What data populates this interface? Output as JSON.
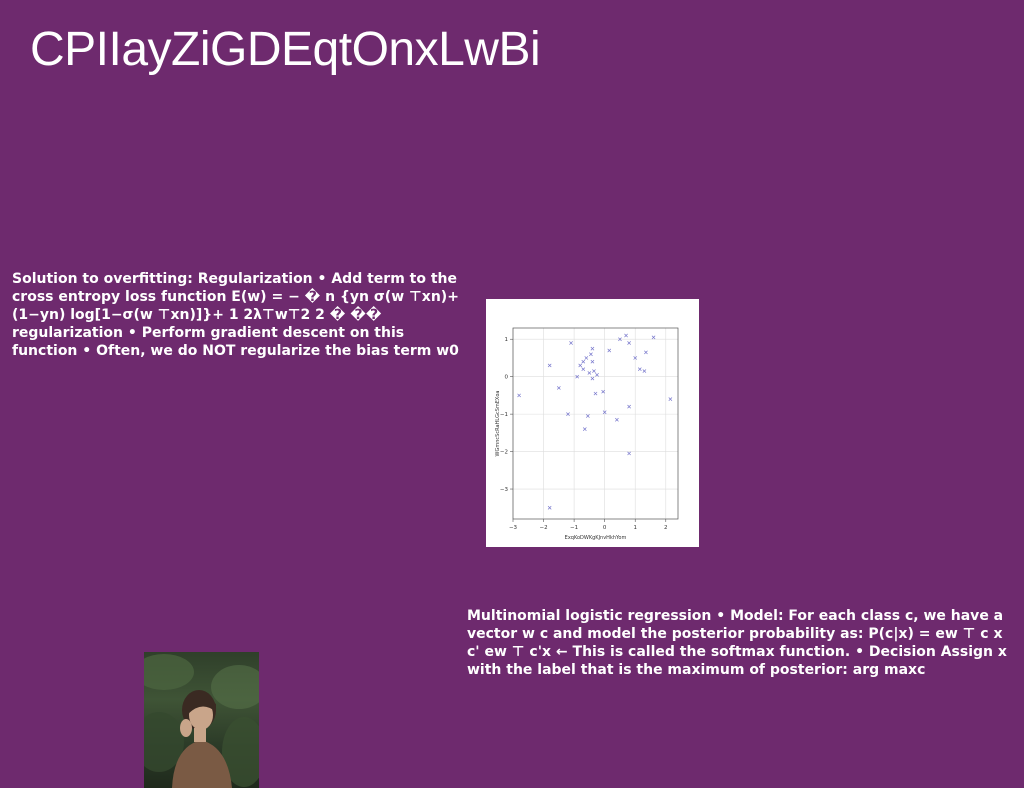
{
  "slide": {
    "title": "CPIIayZiGDEqtOnxLwBi",
    "left_text": "Solution to overfitting: Regularization • Add term to the cross entropy loss function E(w) = − � n {yn σ(w ⊤xn)+(1−yn) log[1−σ(w ⊤xn)]}+ 1 2λ⊤w⊤2 2 � �� regularization • Perform gradient descent on this function • Often, we do NOT regularize the bias term w0",
    "right_text": "Multinomial logistic regression • Model: For each class c, we have a vector w c and model the posterior probability as: P(c|x) = ew ⊤ c x c' ew ⊤ c'x ← This is called the softmax function. • Decision Assign x with the label that is the maximum of posterior: arg maxc"
  },
  "chart_data": {
    "type": "scatter",
    "xlabel": "ExqKoDWKgKJnvHkhYom",
    "ylabel": "WGmncScRaHLGcSmEXoa",
    "xlim": [
      -3,
      2.4
    ],
    "ylim": [
      -3.8,
      1.3
    ],
    "xticks": [
      -3,
      -2,
      -1,
      0,
      1,
      2
    ],
    "yticks": [
      1,
      0,
      -1,
      -2,
      -3
    ],
    "grid": true,
    "marker": "x",
    "color": "#7777cc",
    "series": [
      {
        "name": "",
        "points": [
          [
            -2.8,
            -0.5
          ],
          [
            -1.8,
            0.3
          ],
          [
            -1.5,
            -0.3
          ],
          [
            -1.2,
            -1.0
          ],
          [
            -1.1,
            0.9
          ],
          [
            -0.9,
            0.0
          ],
          [
            -0.8,
            0.3
          ],
          [
            -0.7,
            0.4
          ],
          [
            -0.7,
            0.2
          ],
          [
            -0.65,
            -1.4
          ],
          [
            -0.6,
            0.5
          ],
          [
            -0.55,
            -1.05
          ],
          [
            -0.5,
            0.1
          ],
          [
            -0.45,
            0.6
          ],
          [
            -0.4,
            -0.05
          ],
          [
            -0.4,
            0.4
          ],
          [
            -0.4,
            0.75
          ],
          [
            -0.35,
            0.15
          ],
          [
            -0.3,
            -0.45
          ],
          [
            -0.25,
            0.05
          ],
          [
            -0.05,
            -0.4
          ],
          [
            0.0,
            -0.95
          ],
          [
            0.15,
            0.7
          ],
          [
            0.4,
            -1.15
          ],
          [
            0.5,
            1.0
          ],
          [
            0.7,
            1.1
          ],
          [
            0.8,
            0.9
          ],
          [
            0.8,
            -0.8
          ],
          [
            0.8,
            -2.05
          ],
          [
            1.0,
            0.5
          ],
          [
            1.15,
            0.2
          ],
          [
            1.3,
            0.15
          ],
          [
            1.35,
            0.65
          ],
          [
            1.6,
            1.05
          ],
          [
            2.15,
            -0.6
          ],
          [
            -1.8,
            -3.5
          ]
        ]
      }
    ]
  }
}
